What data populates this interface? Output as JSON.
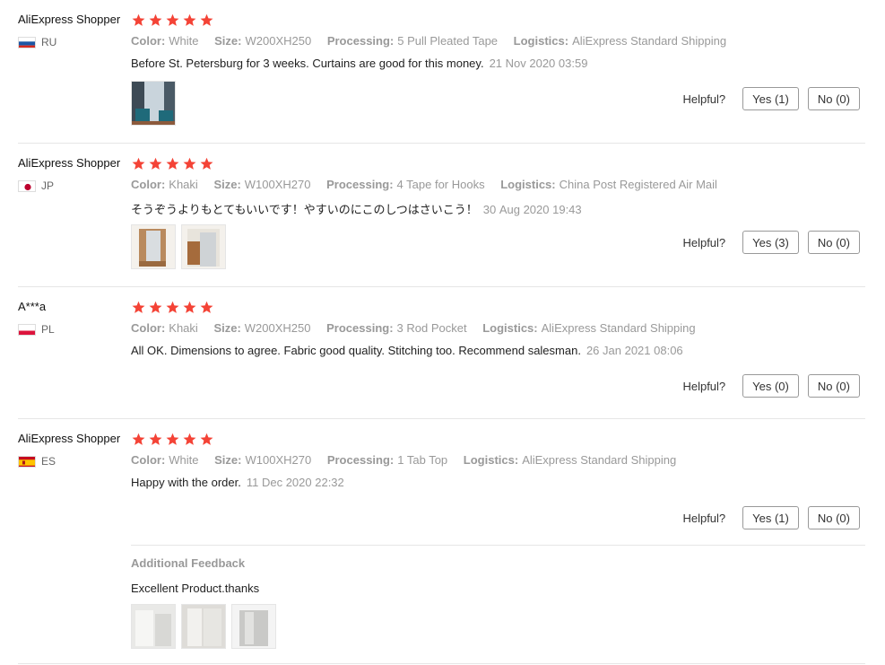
{
  "labels": {
    "color": "Color:",
    "size": "Size:",
    "processing": "Processing:",
    "logistics": "Logistics:",
    "helpful": "Helpful?"
  },
  "colors": {
    "star": "#f44336",
    "divider": "#e6e6e6"
  },
  "reviews": [
    {
      "user": "AliExpress Shopper",
      "country": "RU",
      "stars": 5,
      "color": "White",
      "size": "W200XH250",
      "processing": "5 Pull Pleated Tape",
      "logistics": "AliExpress Standard Shipping",
      "text": "Before St. Petersburg for 3 weeks. Curtains are good for this money.",
      "date": "21 Nov 2020 03:59",
      "yes": "Yes (1)",
      "no": "No (0)"
    },
    {
      "user": "AliExpress Shopper",
      "country": "JP",
      "stars": 5,
      "color": "Khaki",
      "size": "W100XH270",
      "processing": "4 Tape for Hooks",
      "logistics": "China Post Registered Air Mail",
      "text": "そうぞうよりもとてもいいです！やすいのにこのしつはさいこう！",
      "date": "30 Aug 2020 19:43",
      "yes": "Yes (3)",
      "no": "No (0)"
    },
    {
      "user": "A***a",
      "country": "PL",
      "stars": 5,
      "color": "Khaki",
      "size": "W200XH250",
      "processing": "3 Rod Pocket",
      "logistics": "AliExpress Standard Shipping",
      "text": "All OK. Dimensions to agree. Fabric good quality. Stitching too. Recommend salesman.",
      "date": "26 Jan 2021 08:06",
      "yes": "Yes (0)",
      "no": "No (0)"
    },
    {
      "user": "AliExpress Shopper",
      "country": "ES",
      "stars": 5,
      "color": "White",
      "size": "W100XH270",
      "processing": "1 Tab Top",
      "logistics": "AliExpress Standard Shipping",
      "text": "Happy with the order.",
      "date": "11 Dec 2020 22:32",
      "yes": "Yes (1)",
      "no": "No (0)",
      "additional": {
        "title": "Additional Feedback",
        "text": "Excellent Product.thanks"
      }
    }
  ]
}
